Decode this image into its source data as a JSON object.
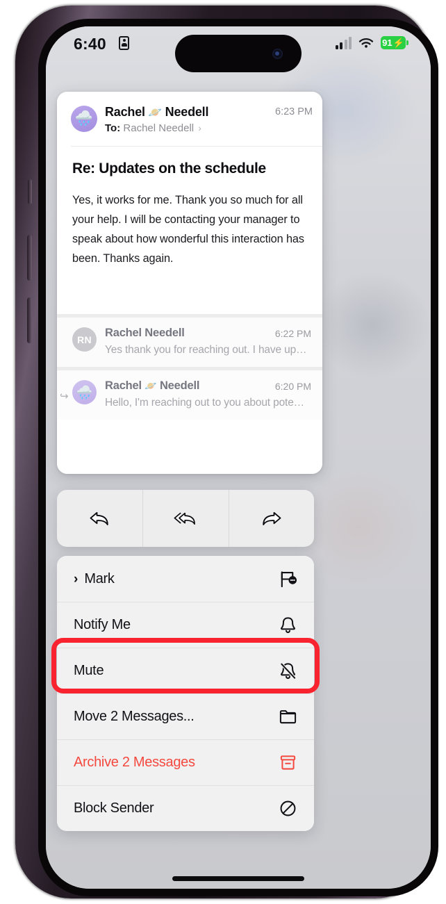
{
  "status_bar": {
    "time": "6:40",
    "time_icon": "id-card-icon",
    "signal_icon": "cellular-signal-icon",
    "wifi_icon": "wifi-icon",
    "battery_level": "91",
    "battery_bolt": "⚡",
    "battery_color": "#2ad043"
  },
  "email": {
    "expanded": {
      "avatar_emoji": "🌧️",
      "sender_name_part1": "Rachel",
      "sender_emoji": "🪐",
      "sender_name_part2": "Needell",
      "time": "6:23 PM",
      "to_label": "To:",
      "to_recipient": "Rachel Needell",
      "to_chevron": "›",
      "subject": "Re: Updates on the schedule",
      "body": "Yes, it works for me. Thank you so much for all your help. I will be contacting your manager to speak about how wonderful this interaction has been. Thanks again."
    },
    "collapsed": [
      {
        "avatar_initials": "RN",
        "sender_name": "Rachel Needell",
        "time": "6:22 PM",
        "preview": "Yes thank you for reaching out. I have up…"
      },
      {
        "avatar_emoji": "🌧️",
        "sender_name_part1": "Rachel",
        "sender_emoji": "🪐",
        "sender_name_part2": "Needell",
        "time": "6:20 PM",
        "preview": "Hello, I'm reaching out to you about pote…",
        "reply_indicator": "↩"
      }
    ]
  },
  "toolbar": {
    "reply_label": "Reply",
    "reply_all_label": "Reply All",
    "forward_label": "Forward"
  },
  "context_menu": {
    "items": [
      {
        "label": "Mark",
        "icon": "flag-with-dots-icon",
        "has_chevron": true,
        "chevron": "›",
        "destructive": false
      },
      {
        "label": "Notify Me",
        "icon": "bell-icon",
        "has_chevron": false,
        "destructive": false
      },
      {
        "label": "Mute",
        "icon": "bell-slash-icon",
        "has_chevron": false,
        "destructive": false,
        "highlighted": true
      },
      {
        "label": "Move 2 Messages...",
        "icon": "folder-icon",
        "has_chevron": false,
        "destructive": false
      },
      {
        "label": "Archive 2 Messages",
        "icon": "archive-box-icon",
        "has_chevron": false,
        "destructive": true
      },
      {
        "label": "Block Sender",
        "icon": "block-circle-icon",
        "has_chevron": false,
        "destructive": false
      }
    ],
    "destructive_color": "#f4493f",
    "highlight_color": "#f8232e"
  }
}
